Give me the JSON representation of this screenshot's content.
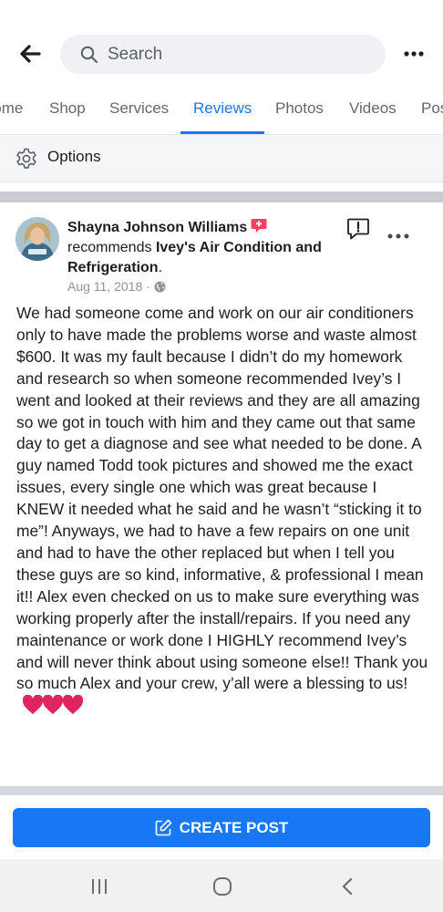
{
  "header": {
    "back_icon": "arrow-left-icon",
    "search_placeholder": "Search",
    "more_icon": "more-horizontal-icon"
  },
  "tabs": [
    {
      "label": "Home"
    },
    {
      "label": "Shop"
    },
    {
      "label": "Services"
    },
    {
      "label": "Reviews",
      "active": true
    },
    {
      "label": "Photos"
    },
    {
      "label": "Videos"
    },
    {
      "label": "Posts"
    }
  ],
  "options": {
    "label": "Options",
    "icon": "gear-icon"
  },
  "post": {
    "author": "Shayna Johnson Williams",
    "action": "recommends",
    "business": "Ivey's Air Condition and Refrigeration",
    "punct": ".",
    "date": "Aug 11, 2018",
    "separator": "·",
    "privacy_icon": "globe-icon",
    "text": "We had someone come and work on our air conditioners only to have made the problems worse and waste almost $600.  It was my fault because I didn’t do my homework and research so when someone recommended Ivey’s I went and looked at their reviews and they are all amazing so we got in touch with him and they came out that same day to get a diagnose and see what needed to be done.  A guy named Todd took pictures and showed me the exact issues, every single one which was great because I KNEW it needed what he said and he wasn’t “sticking it to me”!  Anyways, we had to have a few repairs on one unit and had to have the other replaced but when I tell you these guys are so kind, informative, & professional I mean it!!  Alex even checked on us to make sure everything was working properly after the install/repairs.  If you need any maintenance or work done I HIGHLY recommend Ivey’s and will never think about using someone else!!  Thank you so much Alex and your crew, y’all were a blessing to us!",
    "hearts_icon": "red-heart-icon",
    "heart_color": "#e0245e"
  },
  "create_post": {
    "label": "CREATE POST",
    "icon": "edit-icon"
  },
  "colors": {
    "accent": "#1877f2",
    "separator": "#c9ccd1"
  },
  "nav": [
    "recent-apps-icon",
    "home-icon",
    "back-icon"
  ]
}
